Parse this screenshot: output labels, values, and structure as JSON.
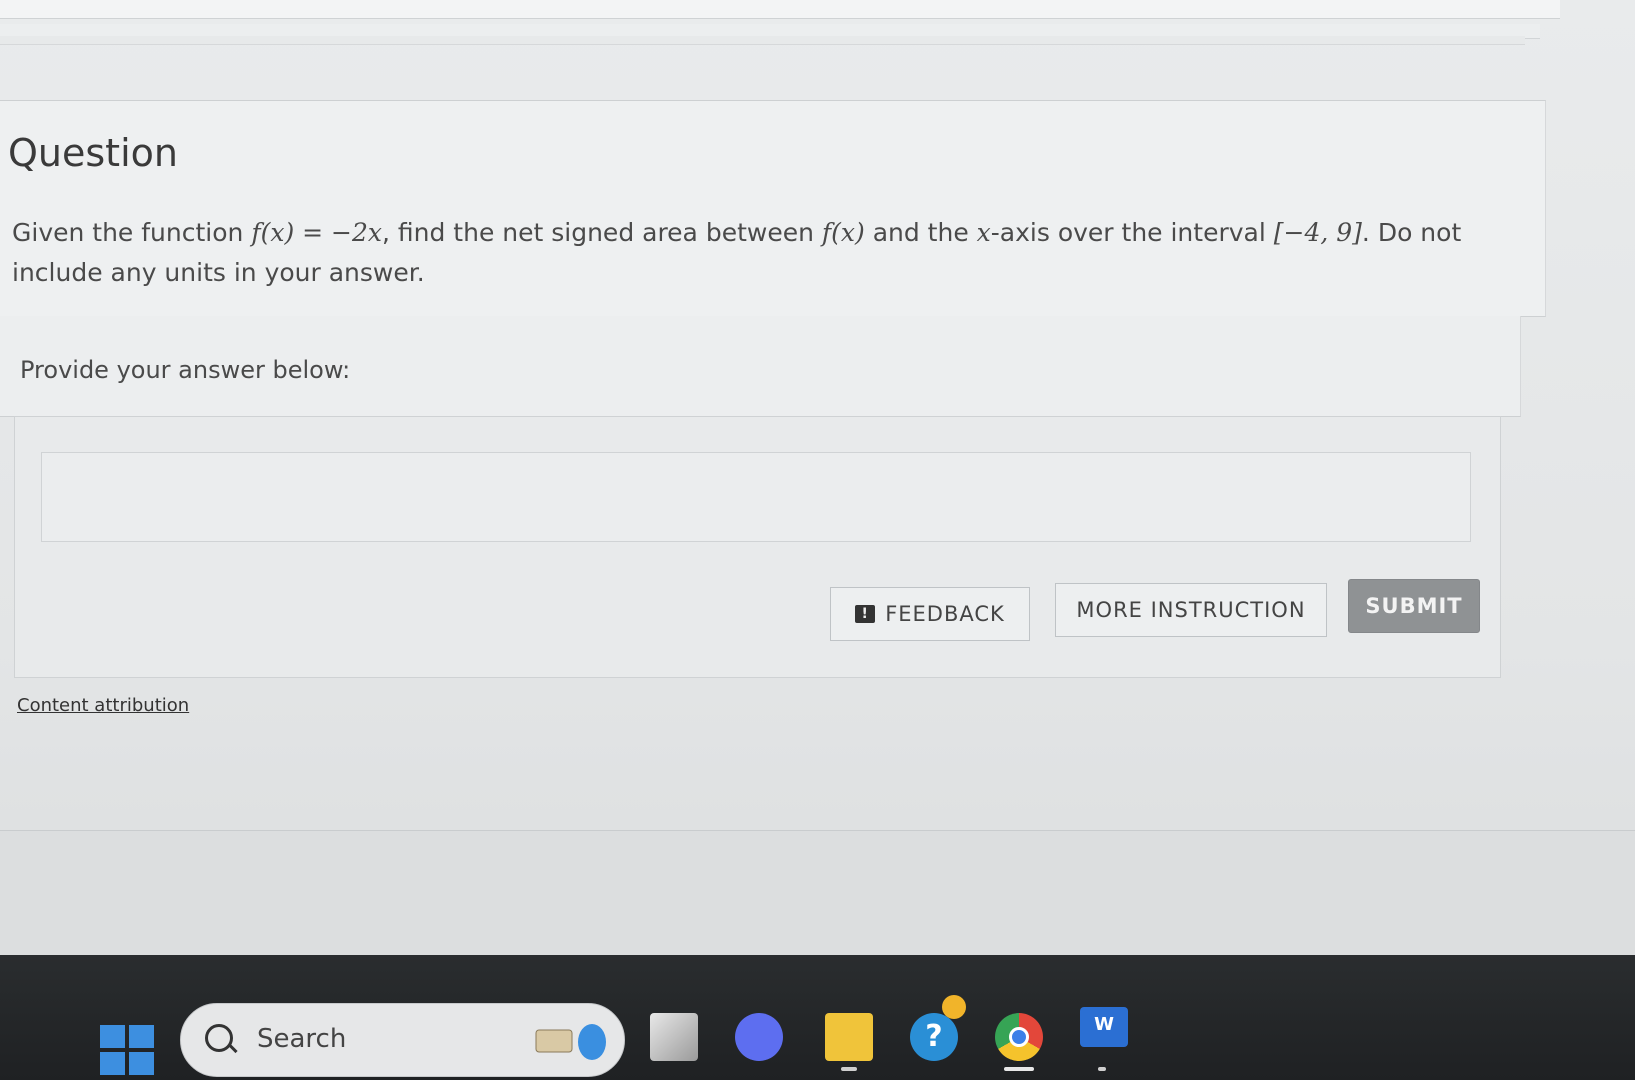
{
  "question": {
    "title": "Question",
    "text_prefix": "Given the function ",
    "function": "f(x) = −2x",
    "text_mid": ", find the net signed area between ",
    "function_ref": "f(x)",
    "text_mid2": " and the ",
    "axis_var": "x",
    "text_mid3": "-axis over the interval ",
    "interval": "[−4, 9]",
    "text_suffix": ". Do not include any units in your answer."
  },
  "answer": {
    "label": "Provide your answer below:",
    "value": ""
  },
  "buttons": {
    "feedback_icon": "!",
    "feedback": "FEEDBACK",
    "more_instruction": "MORE INSTRUCTION",
    "submit": "SUBMIT"
  },
  "footer": {
    "attribution": "Content attribution"
  },
  "taskbar": {
    "search_label": "Search",
    "help_icon": "?",
    "word_icon": "W"
  }
}
